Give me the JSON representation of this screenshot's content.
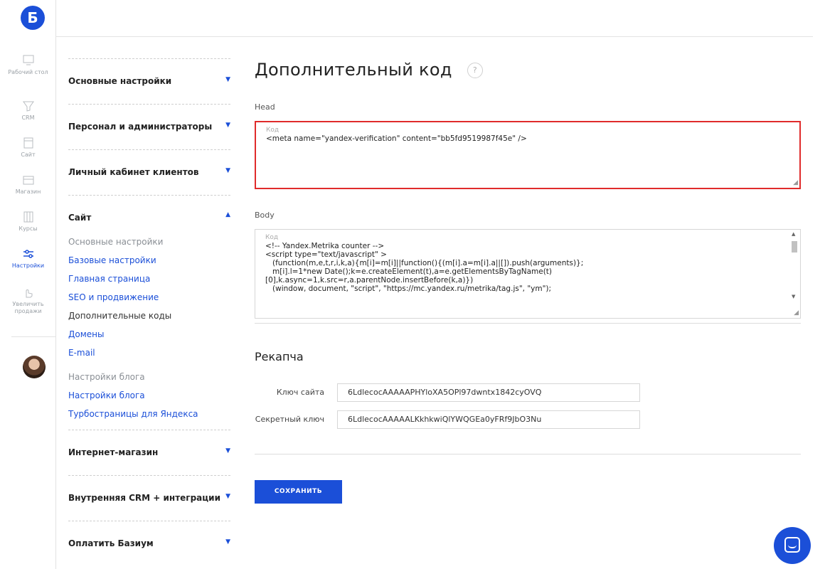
{
  "logo": {
    "letter": "Б"
  },
  "rail": [
    {
      "label": "Рабочий стол",
      "icon": "desktop-icon"
    },
    {
      "label": "CRM",
      "icon": "crm-icon"
    },
    {
      "label": "Сайт",
      "icon": "site-icon"
    },
    {
      "label": "Магазин",
      "icon": "shop-icon"
    },
    {
      "label": "Курсы",
      "icon": "courses-icon"
    },
    {
      "label": "Настройки",
      "icon": "settings-icon",
      "active": true
    },
    {
      "label": "Увеличить продажи",
      "icon": "sales-icon"
    }
  ],
  "menu": {
    "sections": [
      {
        "label": "Основные настройки",
        "expanded": false
      },
      {
        "label": "Персонал и администраторы",
        "expanded": false
      },
      {
        "label": "Личный кабинет клиентов",
        "expanded": false
      }
    ],
    "site": {
      "label": "Сайт",
      "items": [
        {
          "label": "Основные настройки",
          "style": "gray"
        },
        {
          "label": "Базовые настройки",
          "style": "link"
        },
        {
          "label": "Главная страница",
          "style": "link"
        },
        {
          "label": "SEO и продвижение",
          "style": "link"
        },
        {
          "label": "Дополнительные коды",
          "style": "current"
        },
        {
          "label": "Домены",
          "style": "link"
        },
        {
          "label": "E-mail",
          "style": "link"
        },
        {
          "label": "Настройки блога",
          "style": "gray"
        },
        {
          "label": "Настройки блога",
          "style": "link"
        },
        {
          "label": "Турбостраницы для Яндекса",
          "style": "link"
        }
      ]
    },
    "sections_after": [
      {
        "label": "Интернет-магазин",
        "expanded": false
      },
      {
        "label": "Внутренняя CRM + интеграции",
        "expanded": false
      },
      {
        "label": "Оплатить Базиум",
        "expanded": false
      }
    ]
  },
  "main": {
    "title": "Дополнительный код",
    "help": "?",
    "head": {
      "label": "Head",
      "placeholder": "Код",
      "value": "<meta name=\"yandex-verification\" content=\"bb5fd9519987f45e\" />"
    },
    "body": {
      "label": "Body",
      "placeholder": "Код",
      "value": "<!-- Yandex.Metrika counter -->\n<script type=\"text/javascript\" >\n   (function(m,e,t,r,i,k,a){m[i]=m[i]||function(){(m[i].a=m[i].a||[]).push(arguments)};\n   m[i].l=1*new Date();k=e.createElement(t),a=e.getElementsByTagName(t)\n[0],k.async=1,k.src=r,a.parentNode.insertBefore(k,a)})\n   (window, document, \"script\", \"https://mc.yandex.ru/metrika/tag.js\", \"ym\");"
    },
    "recaptcha": {
      "title": "Рекапча",
      "site_key_label": "Ключ сайта",
      "site_key": "6LdlecocAAAAAPHYloXA5OPl97dwntx1842cyOVQ",
      "secret_key_label": "Секретный ключ",
      "secret_key": "6LdlecocAAAAALKkhkwiQlYWQGEa0yFRf9JbO3Nu"
    },
    "save_label": "СОХРАНИТЬ"
  },
  "colors": {
    "accent": "#1b4fd8",
    "error_border": "#e02b2b"
  }
}
